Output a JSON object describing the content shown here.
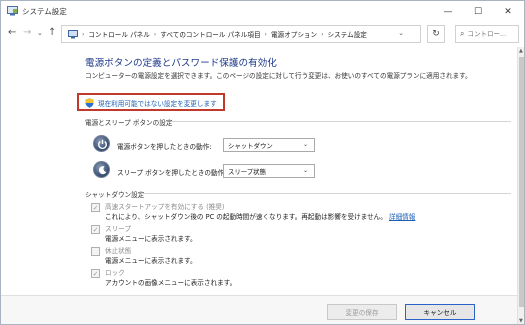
{
  "window": {
    "title": "システム設定",
    "minimize_glyph": "—",
    "maximize_glyph": "☐",
    "close_glyph": "✕"
  },
  "nav": {
    "back_glyph": "←",
    "forward_glyph": "→",
    "up_glyph": "↑",
    "recent_glyph": "⌄",
    "refresh_glyph": "↻",
    "search_glyph": "⌕"
  },
  "breadcrumb": {
    "separator": "›",
    "items": [
      "コントロール パネル",
      "すべてのコントロール パネル項目",
      "電源オプション",
      "システム設定"
    ],
    "dropdown_glyph": "⌄"
  },
  "search": {
    "placeholder": "コントロー..."
  },
  "main": {
    "title": "電源ボタンの定義とパスワード保護の有効化",
    "description": "コンピューターの電源設定を選択できます。このページの設定に対して行う変更は、お使いのすべての電源プランに適用されます。",
    "change_link": "現在利用可能ではない設定を変更します"
  },
  "power_section": {
    "heading": "電源とスリープ ボタンの設定",
    "rows": [
      {
        "label": "電源ボタンを押したときの動作:",
        "value": "シャットダウン"
      },
      {
        "label": "スリープ ボタンを押したときの動作:",
        "value": "スリープ状態"
      }
    ],
    "caret_glyph": "⌄"
  },
  "shutdown_section": {
    "heading": "シャットダウン設定",
    "items": [
      {
        "title": "高速スタートアップを有効にする (推奨)",
        "desc": "これにより、シャットダウン後の PC の起動時間が速くなります。再起動は影響を受けません。",
        "link": "詳細情報",
        "checked": true
      },
      {
        "title": "スリープ",
        "desc": "電源メニューに表示されます。",
        "checked": true
      },
      {
        "title": "休止状態",
        "desc": "電源メニューに表示されます。",
        "checked": false
      },
      {
        "title": "ロック",
        "desc": "アカウントの画像メニューに表示されます。",
        "checked": true
      }
    ],
    "check_glyph": "✓"
  },
  "footer": {
    "save_label": "変更の保存",
    "cancel_label": "キャンセル"
  },
  "scrollbar": {
    "up_glyph": "▲",
    "down_glyph": "▼"
  }
}
